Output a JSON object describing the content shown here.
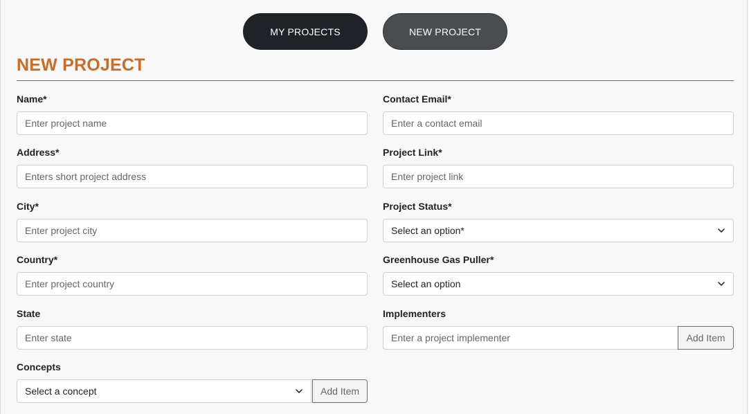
{
  "nav": {
    "my_projects": "MY PROJECTS",
    "new_project": "NEW PROJECT"
  },
  "page": {
    "title": "NEW PROJECT"
  },
  "form": {
    "name": {
      "label": "Name*",
      "placeholder": "Enter project name"
    },
    "address": {
      "label": "Address*",
      "placeholder": "Enters short project address"
    },
    "city": {
      "label": "City*",
      "placeholder": "Enter project city"
    },
    "country": {
      "label": "Country*",
      "placeholder": "Enter project country"
    },
    "state": {
      "label": "State",
      "placeholder": "Enter state"
    },
    "concepts": {
      "label": "Concepts",
      "selected": "Select a concept",
      "add_label": "Add Item"
    },
    "contact_email": {
      "label": "Contact Email*",
      "placeholder": "Enter a contact email"
    },
    "project_link": {
      "label": "Project Link*",
      "placeholder": "Enter project link"
    },
    "project_status": {
      "label": "Project Status*",
      "selected": "Select an option*"
    },
    "ghg_puller": {
      "label": "Greenhouse Gas Puller*",
      "selected": "Select an option"
    },
    "implementers": {
      "label": "Implementers",
      "placeholder": "Enter a project implementer",
      "add_label": "Add Item"
    }
  },
  "icons": {
    "dropdown": "chevron-down-icon"
  },
  "colors": {
    "accent": "#cf6a24",
    "button_dark": "#1f2226",
    "button_gray": "#4a4d50"
  }
}
